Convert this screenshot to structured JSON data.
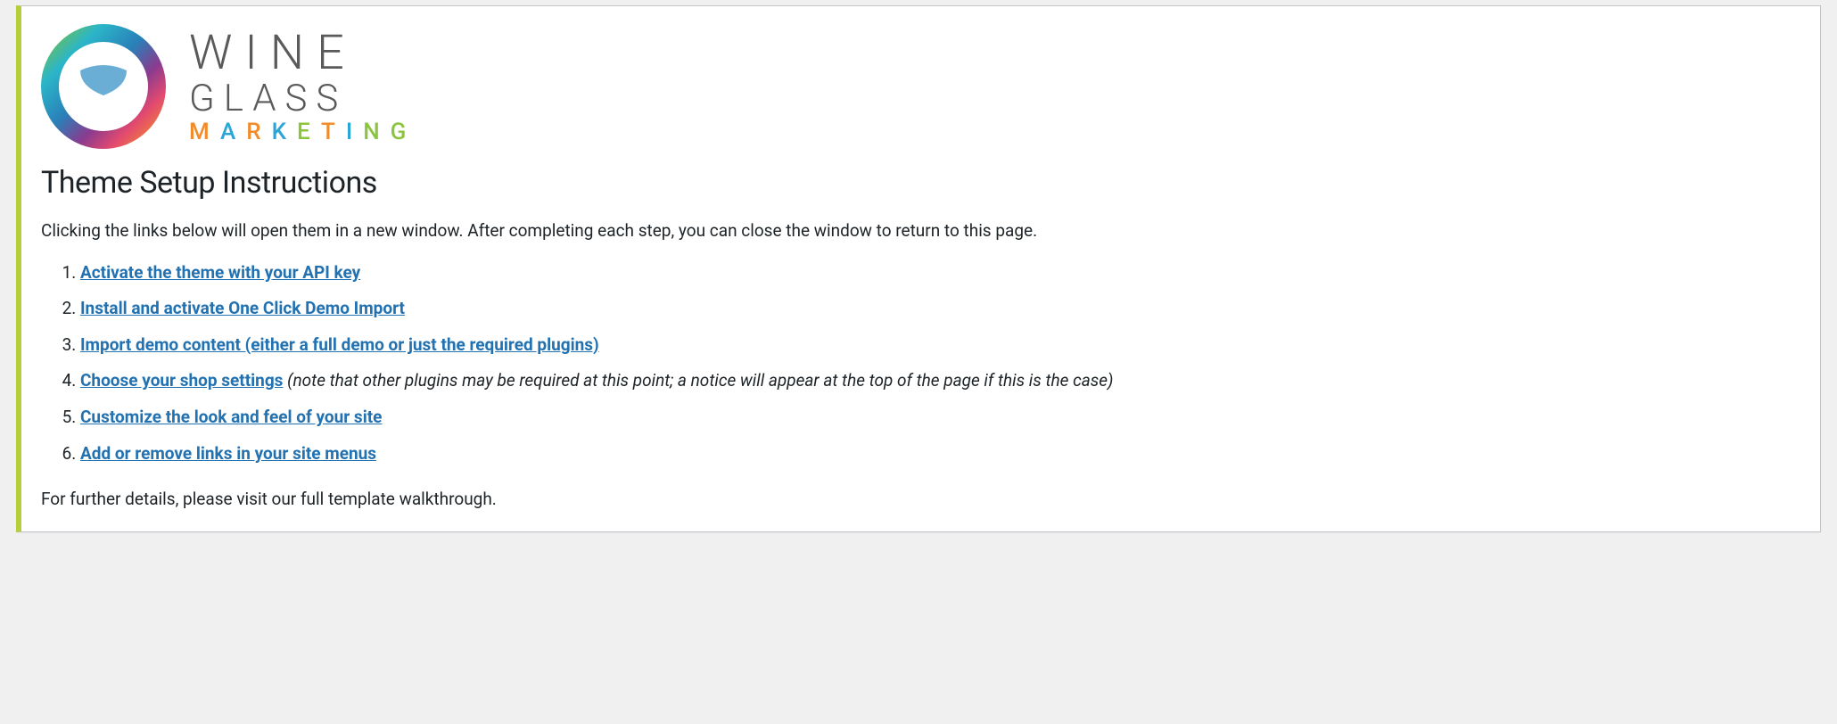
{
  "logo": {
    "line1": "WINE",
    "line2": "GLASS",
    "line3_letters": [
      "M",
      "A",
      "R",
      "K",
      "E",
      "T",
      "I",
      "N",
      "G"
    ]
  },
  "title": "Theme Setup Instructions",
  "intro": "Clicking the links below will open them in a new window. After completing each step, you can close the window to return to this page.",
  "steps": [
    {
      "link": "Activate the theme with your API key",
      "note": ""
    },
    {
      "link": "Install and activate One Click Demo Import",
      "note": ""
    },
    {
      "link": "Import demo content (either a full demo or just the required plugins)",
      "note": ""
    },
    {
      "link": "Choose your shop settings",
      "note": "(note that other plugins may be required at this point; a notice will appear at the top of the page if this is the case)"
    },
    {
      "link": "Customize the look and feel of your site",
      "note": ""
    },
    {
      "link": "Add or remove links in your site menus",
      "note": ""
    }
  ],
  "footer": "For further details, please visit our full template walkthrough."
}
